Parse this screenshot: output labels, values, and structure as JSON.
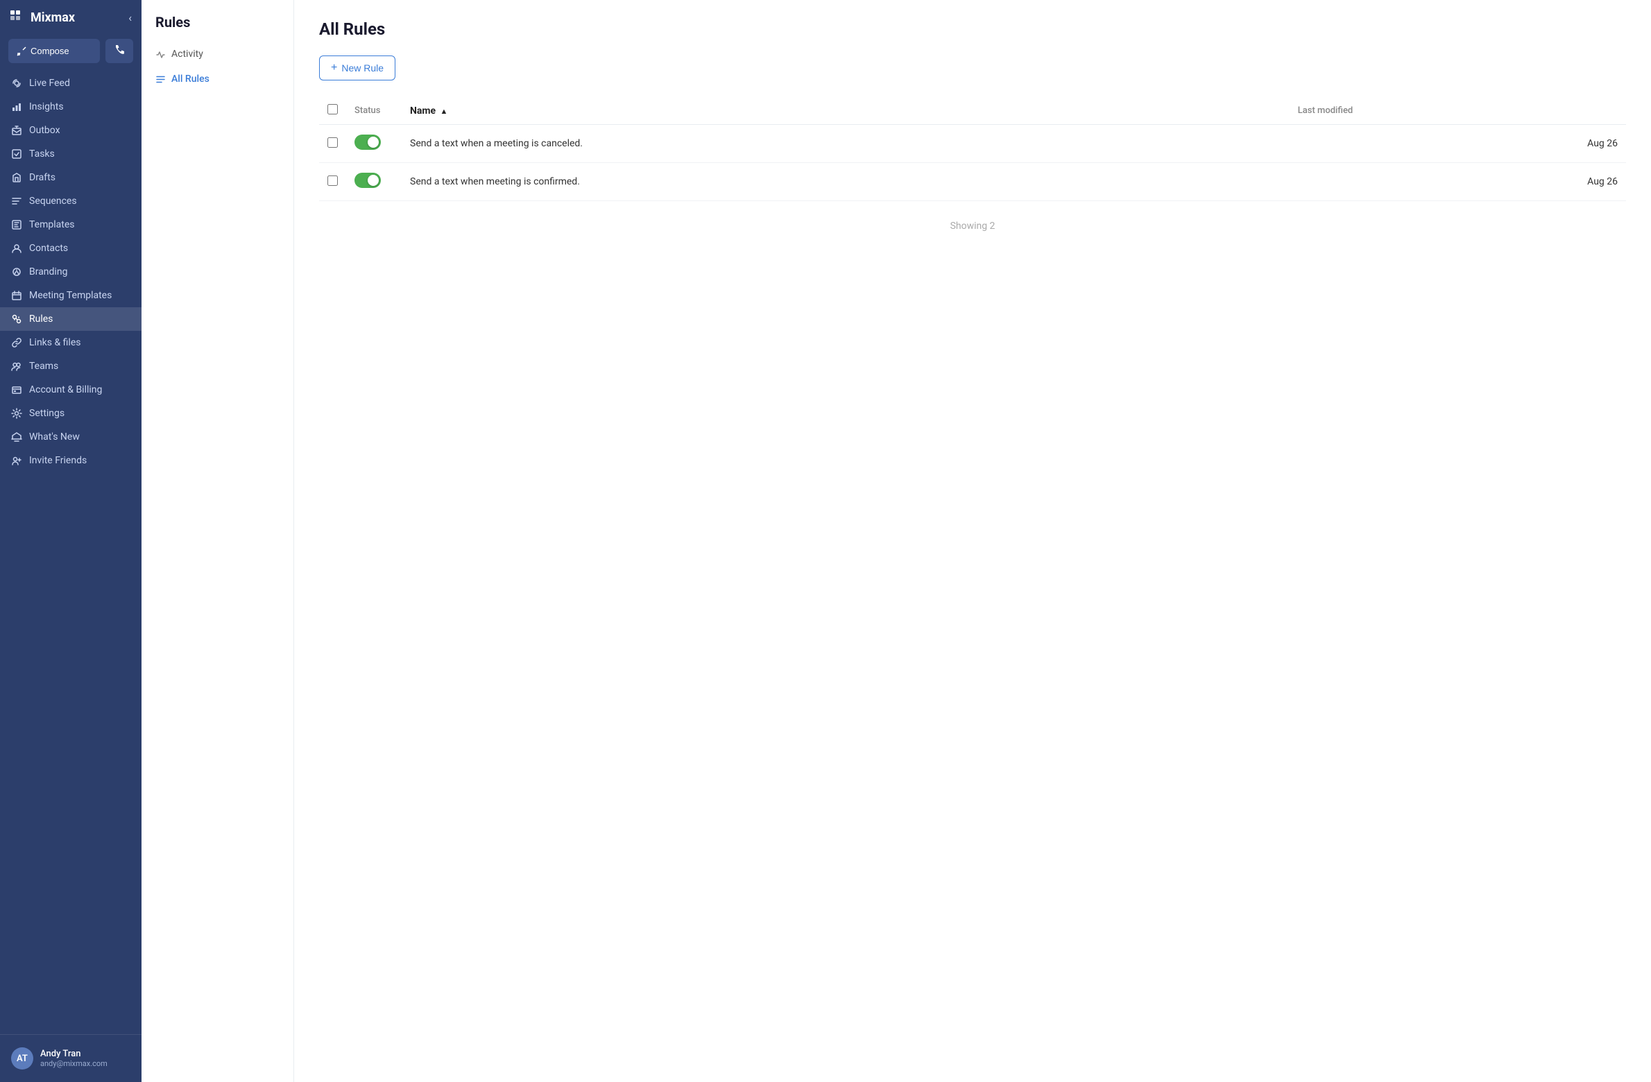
{
  "app": {
    "name": "Mixmax",
    "collapse_label": "‹"
  },
  "sidebar": {
    "compose_label": "Compose",
    "phone_label": "✆",
    "nav_items": [
      {
        "id": "live-feed",
        "label": "Live Feed",
        "icon": "live"
      },
      {
        "id": "insights",
        "label": "Insights",
        "icon": "insights"
      },
      {
        "id": "outbox",
        "label": "Outbox",
        "icon": "outbox"
      },
      {
        "id": "tasks",
        "label": "Tasks",
        "icon": "tasks"
      },
      {
        "id": "drafts",
        "label": "Drafts",
        "icon": "drafts"
      },
      {
        "id": "sequences",
        "label": "Sequences",
        "icon": "sequences"
      },
      {
        "id": "templates",
        "label": "Templates",
        "icon": "templates"
      },
      {
        "id": "contacts",
        "label": "Contacts",
        "icon": "contacts"
      },
      {
        "id": "branding",
        "label": "Branding",
        "icon": "branding"
      },
      {
        "id": "meeting-templates",
        "label": "Meeting Templates",
        "icon": "meeting"
      },
      {
        "id": "rules",
        "label": "Rules",
        "icon": "rules",
        "active": true
      },
      {
        "id": "links-files",
        "label": "Links & files",
        "icon": "links"
      },
      {
        "id": "teams",
        "label": "Teams",
        "icon": "teams"
      },
      {
        "id": "account-billing",
        "label": "Account & Billing",
        "icon": "billing"
      },
      {
        "id": "settings",
        "label": "Settings",
        "icon": "settings"
      },
      {
        "id": "whats-new",
        "label": "What's New",
        "icon": "new"
      },
      {
        "id": "invite-friends",
        "label": "Invite Friends",
        "icon": "invite"
      }
    ],
    "user": {
      "name": "Andy Tran",
      "email": "andy@mixmax.com",
      "initials": "AT"
    }
  },
  "sub_sidebar": {
    "title": "Rules",
    "items": [
      {
        "id": "activity",
        "label": "Activity",
        "icon": "activity"
      },
      {
        "id": "all-rules",
        "label": "All Rules",
        "icon": "list",
        "active": true
      }
    ]
  },
  "main": {
    "title": "All Rules",
    "new_rule_label": "New Rule",
    "table": {
      "col_status": "Status",
      "col_name": "Name",
      "col_last_modified": "Last modified",
      "rows": [
        {
          "enabled": true,
          "name": "Send a text when a meeting is canceled.",
          "last_modified": "Aug 26"
        },
        {
          "enabled": true,
          "name": "Send a text when meeting is confirmed.",
          "last_modified": "Aug 26"
        }
      ]
    },
    "showing_text": "Showing 2"
  }
}
